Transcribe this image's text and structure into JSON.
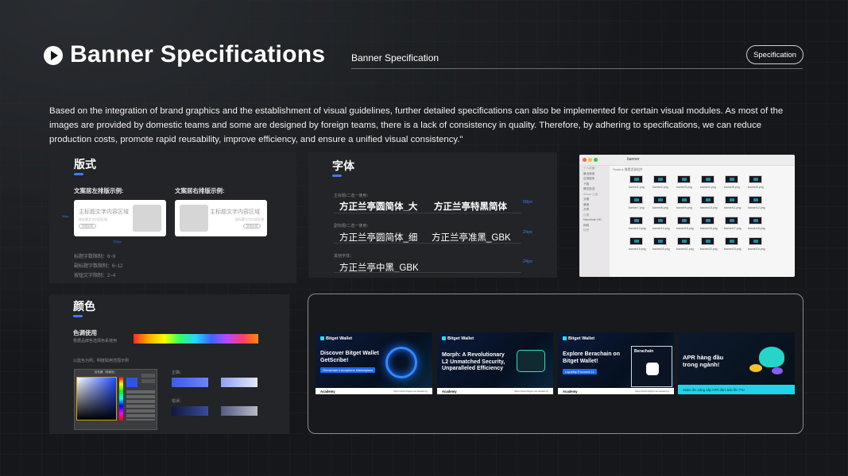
{
  "header": {
    "title": "Banner Specifications",
    "subtitle": "Banner Specification",
    "pill_label": "Specification"
  },
  "intro": "Based on the integration of brand graphics and the establishment of visual guidelines, further detailed specifications can also be implemented for certain visual modules. As most of the images are provided by domestic teams and some are designed by foreign teams, there is a lack of consistency in quality. Therefore, by adhering to specifications, we can reduce production costs, promote rapid reusability, improve efficiency, and ensure a unified visual consistency.\"",
  "layout_panel": {
    "title": "版式",
    "left_label": "文案居左排版示例:",
    "right_label": "文案居右排版示例:",
    "card_title": "主标题文字内容区域",
    "card_sub": "副标题文字内容区域",
    "card_button": "按钮区域",
    "width_note": "750px",
    "height_note": "36px",
    "rules": [
      "标题字数限制：6~9",
      "副标题字数限制：6~12",
      "按钮文字限制：2~4"
    ]
  },
  "font_panel": {
    "title": "字体",
    "rows": [
      {
        "label": "主标题/二选一使用：",
        "samples": [
          "方正兰亭圆简体_大",
          "方正兰亭特黑简体"
        ],
        "size": "58px"
      },
      {
        "label": "副标题/二选一使用：",
        "samples": [
          "方正兰亭圆简体_细",
          "方正兰亭准黑_GBK"
        ],
        "size": "24px"
      },
      {
        "label": "其他字体：",
        "samples": [
          "方正兰亭中黑_GBK"
        ],
        "size": "24px"
      }
    ]
  },
  "finder": {
    "window_title": "banner",
    "path": "Finder ▸ 像素资源组件",
    "sidebar": [
      "个人收藏",
      "最近使用",
      "应用程序",
      "下载",
      "隔空投送",
      "iCloud 云盘",
      "文稿",
      "桌面",
      "共享",
      "位置",
      "Macintosh HD",
      "网络",
      "标签"
    ],
    "files": [
      "banner1.png",
      "banner2.png",
      "banner3.png",
      "banner4.png",
      "banner5.png",
      "banner6.png",
      "banner7.png",
      "banner8.png",
      "banner9.png",
      "banner10.png",
      "banner11.png",
      "banner12.png",
      "banner13.png",
      "banner14.png",
      "banner15.png",
      "banner16.png",
      "banner17.png",
      "banner18.png",
      "banner19.png",
      "banner20.png",
      "banner21.png",
      "banner22.png",
      "banner23.png",
      "banner24.png"
    ]
  },
  "color_panel": {
    "title": "颜色",
    "subtitle": "色调使用",
    "note": "根据品牌色选择色系使用",
    "example_note": "以蓝色为例，明度取用范围示例",
    "correct_label": "正确：",
    "wrong_label": "错误：",
    "picker_title": "拾色器（前景色）",
    "colors": {
      "correct_a": "#4f6ff0",
      "correct_b": "#b8c3f5",
      "wrong_a": "#1a2455",
      "wrong_b": "#7c86a8"
    }
  },
  "banners": [
    {
      "logo": "Bitget Wallet",
      "title": "Discover Bitget Wallet GetScribe!",
      "tag": "Omnichain Inscriptions Marketplace",
      "foot": "Academy",
      "url": "https://www.bitget.com/academy"
    },
    {
      "logo": "Bitget Wallet",
      "title": "Morph: A Revolutionary L2 Unmatched Security, Unparalleled Efficiency",
      "tag": "",
      "foot": "Academy",
      "url": "https://www.bitget.com/academy"
    },
    {
      "logo": "Bitget Wallet",
      "title": "Explore Berachain on Bitget Wallet!",
      "tag": "Liquidity-Focused L1",
      "side": "Berachain",
      "foot": "Academy",
      "url": "https://www.bitget.com/academy"
    },
    {
      "logo": "",
      "title": "APR hàng đầu trong ngành!",
      "tag": "",
      "foot": "Stake ​​lên nâng cấp APR đảm bảo lên 7%!",
      "url": ""
    }
  ]
}
